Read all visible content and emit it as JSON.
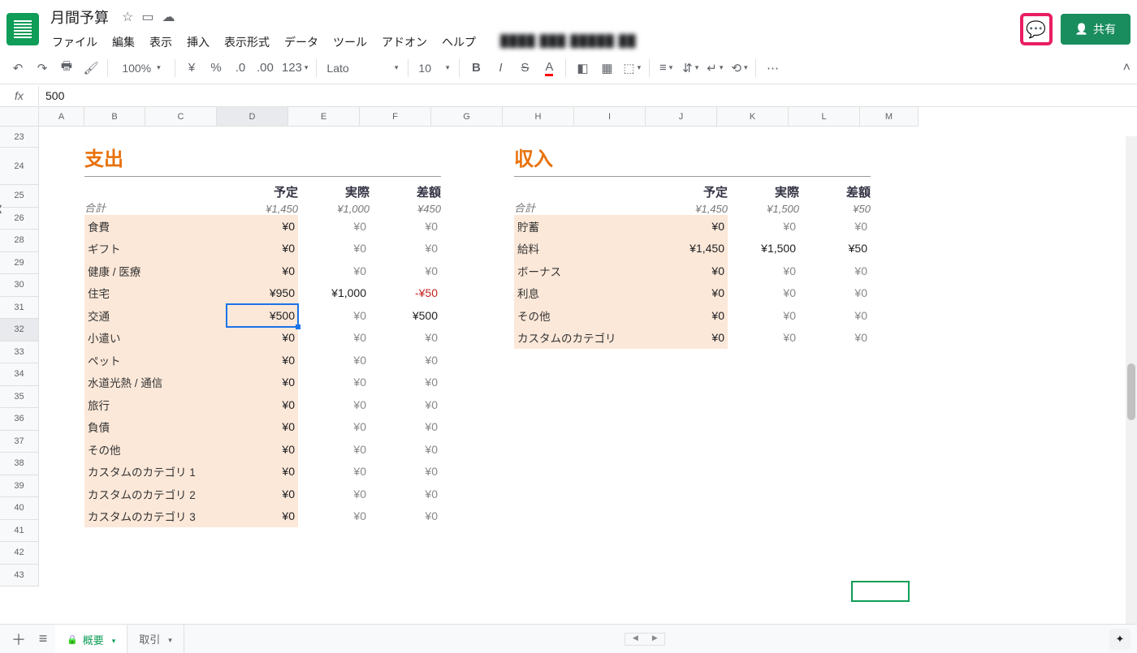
{
  "doc": {
    "title": "月間予算"
  },
  "menus": [
    "ファイル",
    "編集",
    "表示",
    "挿入",
    "表示形式",
    "データ",
    "ツール",
    "アドオン",
    "ヘルプ"
  ],
  "share_label": "共有",
  "toolbar": {
    "zoom": "100%",
    "font": "Lato",
    "font_size": "10",
    "num_format": "123"
  },
  "formula_bar": {
    "fx": "fx",
    "value": "500"
  },
  "columns": [
    "A",
    "B",
    "C",
    "D",
    "E",
    "F",
    "G",
    "H",
    "I",
    "J",
    "K",
    "L",
    "M"
  ],
  "row_start": 23,
  "row_labels": [
    "23",
    "24",
    "25",
    "26",
    "28",
    "29",
    "30",
    "31",
    "32",
    "33",
    "34",
    "35",
    "36",
    "37",
    "38",
    "39",
    "40",
    "41",
    "42",
    "43"
  ],
  "selected_row": "32",
  "selected_col": "D",
  "expenses": {
    "title": "支出",
    "headers": [
      "予定",
      "実際",
      "差額"
    ],
    "total_label": "合計",
    "totals": [
      "¥1,450",
      "¥1,000",
      "¥450"
    ],
    "rows": [
      {
        "label": "食費",
        "c": [
          "¥0",
          "¥0",
          "¥0"
        ]
      },
      {
        "label": "ギフト",
        "c": [
          "¥0",
          "¥0",
          "¥0"
        ]
      },
      {
        "label": "健康 / 医療",
        "c": [
          "¥0",
          "¥0",
          "¥0"
        ]
      },
      {
        "label": "住宅",
        "c": [
          "¥950",
          "¥1,000",
          "-¥50"
        ],
        "neg": true
      },
      {
        "label": "交通",
        "c": [
          "¥500",
          "¥0",
          "¥500"
        ],
        "active": true
      },
      {
        "label": "小遣い",
        "c": [
          "¥0",
          "¥0",
          "¥0"
        ]
      },
      {
        "label": "ペット",
        "c": [
          "¥0",
          "¥0",
          "¥0"
        ]
      },
      {
        "label": "水道光熱 / 通信",
        "c": [
          "¥0",
          "¥0",
          "¥0"
        ]
      },
      {
        "label": "旅行",
        "c": [
          "¥0",
          "¥0",
          "¥0"
        ]
      },
      {
        "label": "負債",
        "c": [
          "¥0",
          "¥0",
          "¥0"
        ]
      },
      {
        "label": "その他",
        "c": [
          "¥0",
          "¥0",
          "¥0"
        ]
      },
      {
        "label": "カスタムのカテゴリ 1",
        "c": [
          "¥0",
          "¥0",
          "¥0"
        ]
      },
      {
        "label": "カスタムのカテゴリ 2",
        "c": [
          "¥0",
          "¥0",
          "¥0"
        ]
      },
      {
        "label": "カスタムのカテゴリ 3",
        "c": [
          "¥0",
          "¥0",
          "¥0"
        ]
      }
    ]
  },
  "income": {
    "title": "収入",
    "headers": [
      "予定",
      "実際",
      "差額"
    ],
    "total_label": "合計",
    "totals": [
      "¥1,450",
      "¥1,500",
      "¥50"
    ],
    "rows": [
      {
        "label": "貯蓄",
        "c": [
          "¥0",
          "¥0",
          "¥0"
        ]
      },
      {
        "label": "給料",
        "c": [
          "¥1,450",
          "¥1,500",
          "¥50"
        ]
      },
      {
        "label": "ボーナス",
        "c": [
          "¥0",
          "¥0",
          "¥0"
        ]
      },
      {
        "label": "利息",
        "c": [
          "¥0",
          "¥0",
          "¥0"
        ]
      },
      {
        "label": "その他",
        "c": [
          "¥0",
          "¥0",
          "¥0"
        ]
      },
      {
        "label": "カスタムのカテゴリ",
        "c": [
          "¥0",
          "¥0",
          "¥0"
        ]
      }
    ]
  },
  "tabs": {
    "active": "概要",
    "other": "取引"
  }
}
